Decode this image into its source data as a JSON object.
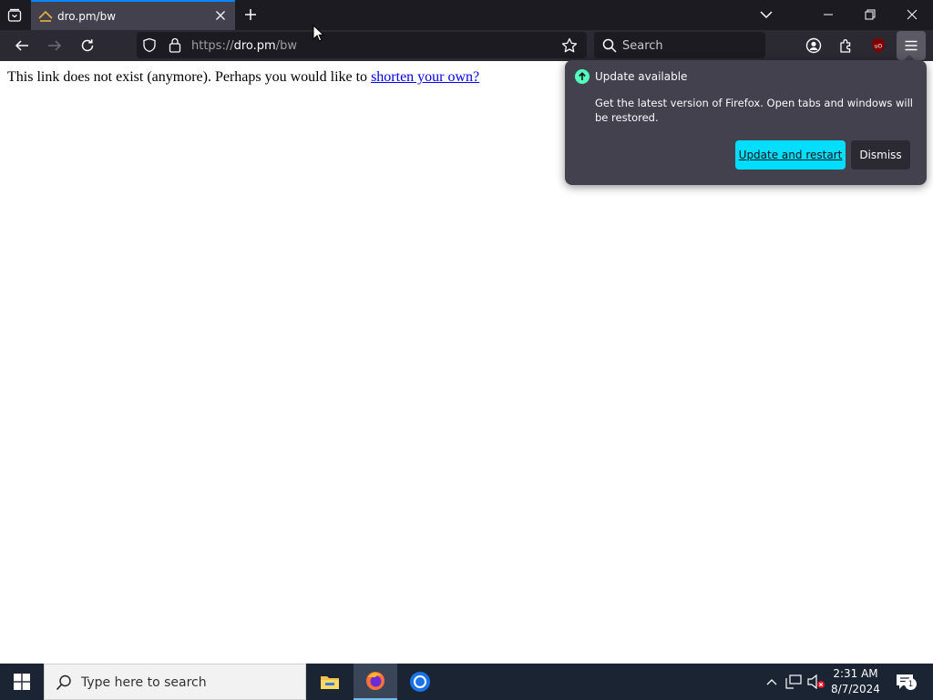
{
  "tab": {
    "title": "dro.pm/bw"
  },
  "url": {
    "scheme": "https://",
    "host": "dro.pm",
    "path": "/bw"
  },
  "search": {
    "placeholder": "Search"
  },
  "page": {
    "message": "This link does not exist (anymore). Perhaps you would like to ",
    "link_text": "shorten your own?"
  },
  "update_panel": {
    "title": "Update available",
    "description": "Get the latest version of Firefox. Open tabs and windows will be restored.",
    "primary_button": "Update and restart",
    "secondary_button": "Dismiss"
  },
  "taskbar": {
    "search_placeholder": "Type here to search",
    "time": "2:31 AM",
    "date": "8/7/2024",
    "notification_count": "1"
  },
  "colors": {
    "tabstrip_bg": "#1c1b22",
    "toolbar_bg": "#2b2a33",
    "panel_bg": "#42414d",
    "accent_cyan": "#00ddff",
    "update_green": "#54ffbd",
    "taskbar_bg": "#1a2433"
  },
  "icons": {
    "tab_list": "tab-list-icon",
    "favicon": "favicon-icon",
    "close": "close-icon",
    "new_tab": "plus-icon",
    "back": "arrow-left-icon",
    "forward": "arrow-right-icon",
    "reload": "reload-icon",
    "shield": "shield-icon",
    "lock": "lock-icon",
    "star": "star-icon",
    "search": "search-icon",
    "account": "account-icon",
    "extensions": "puzzle-icon",
    "ublock": "ublock-icon",
    "menu": "hamburger-icon",
    "windows": "windows-logo-icon",
    "explorer": "folder-icon",
    "firefox": "firefox-icon",
    "chrome": "chrome-icon"
  }
}
